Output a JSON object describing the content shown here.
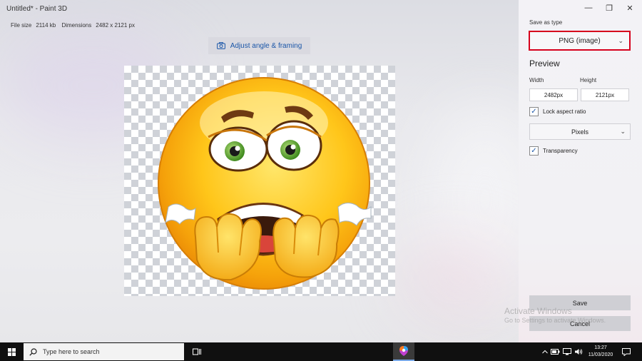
{
  "window": {
    "title": "Untitled* - Paint 3D",
    "file_size_label": "File size",
    "file_size_value": "2114 kb",
    "dimensions_label": "Dimensions",
    "dimensions_value": "2482 x 2121 px",
    "controls": {
      "minimize": "—",
      "restore": "❐",
      "close": "✕"
    }
  },
  "toolbar": {
    "adjust_label": "Adjust angle & framing",
    "adjust_icon": "camera-icon"
  },
  "save_panel": {
    "save_as_type_label": "Save as type",
    "save_as_type_value": "PNG (image)",
    "preview_heading": "Preview",
    "width_label": "Width",
    "width_value": "2482px",
    "height_label": "Height",
    "height_value": "2121px",
    "lock_aspect_label": "Lock aspect ratio",
    "lock_aspect_checked": true,
    "units_value": "Pixels",
    "transparency_label": "Transparency",
    "transparency_checked": true,
    "save_label": "Save",
    "cancel_label": "Cancel",
    "highlight_color": "#d6001c"
  },
  "watermark": {
    "line1": "Activate Windows",
    "line2": "Go to Settings to activate Windows."
  },
  "taskbar": {
    "search_placeholder": "Type here to search",
    "clock_time": "13:27",
    "clock_date": "11/03/2020"
  }
}
